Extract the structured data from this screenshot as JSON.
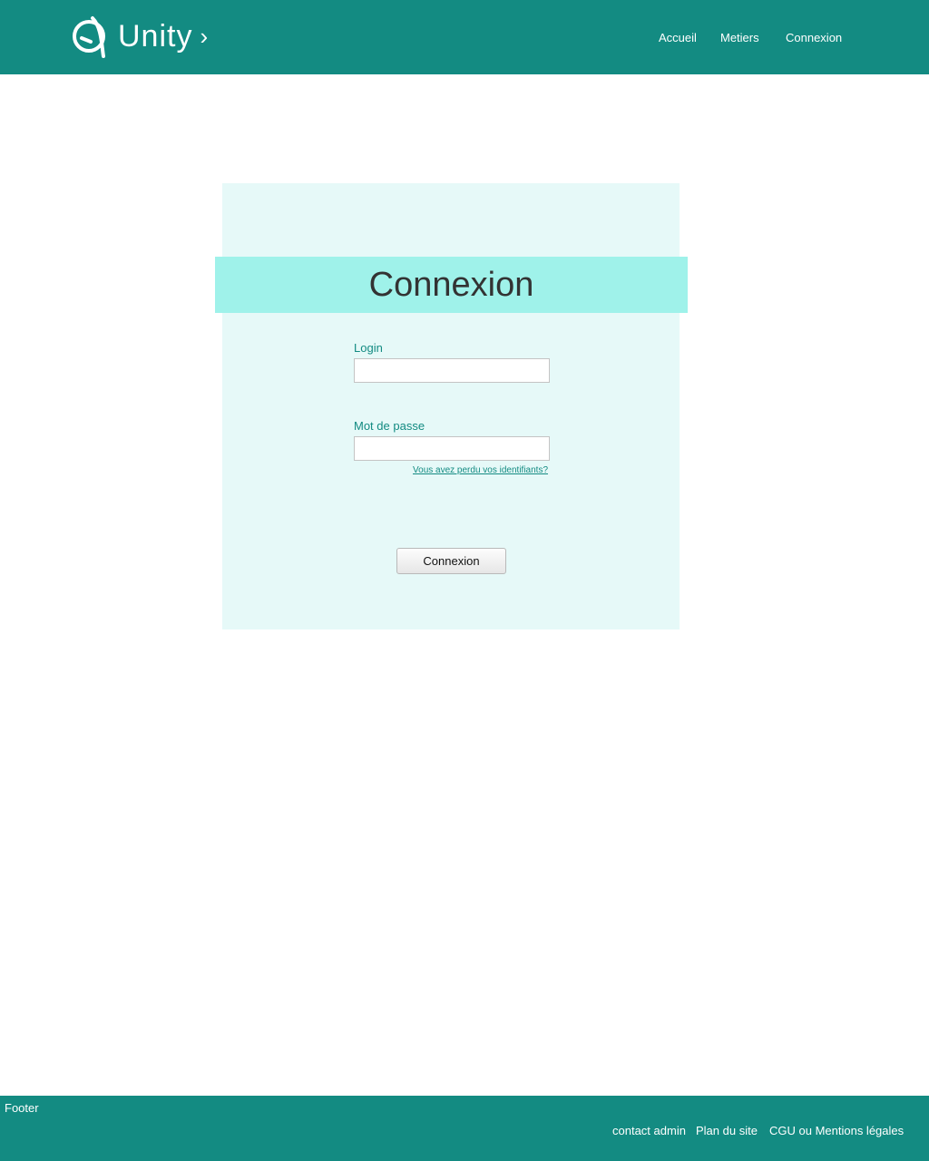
{
  "header": {
    "brand": "Unity",
    "brand_chevron": "›",
    "logo_icon": "unity-q-logo-icon",
    "nav": {
      "home": "Accueil",
      "jobs": "Metiers",
      "login": "Connexion"
    }
  },
  "login_form": {
    "title": "Connexion",
    "login_label": "Login",
    "login_value": "",
    "password_label": "Mot de passe",
    "password_value": "",
    "forgot_link": "Vous avez perdu vos identifiants?",
    "submit_label": "Connexion"
  },
  "footer": {
    "title": "Footer",
    "links": {
      "contact": "contact admin",
      "sitemap": "Plan du site",
      "legal": "CGU ou Mentions légales"
    }
  },
  "colors": {
    "brand_teal": "#138b82",
    "panel_bg": "#e6f9f8",
    "title_band": "#9ff2ea",
    "label_text": "#138b82"
  }
}
